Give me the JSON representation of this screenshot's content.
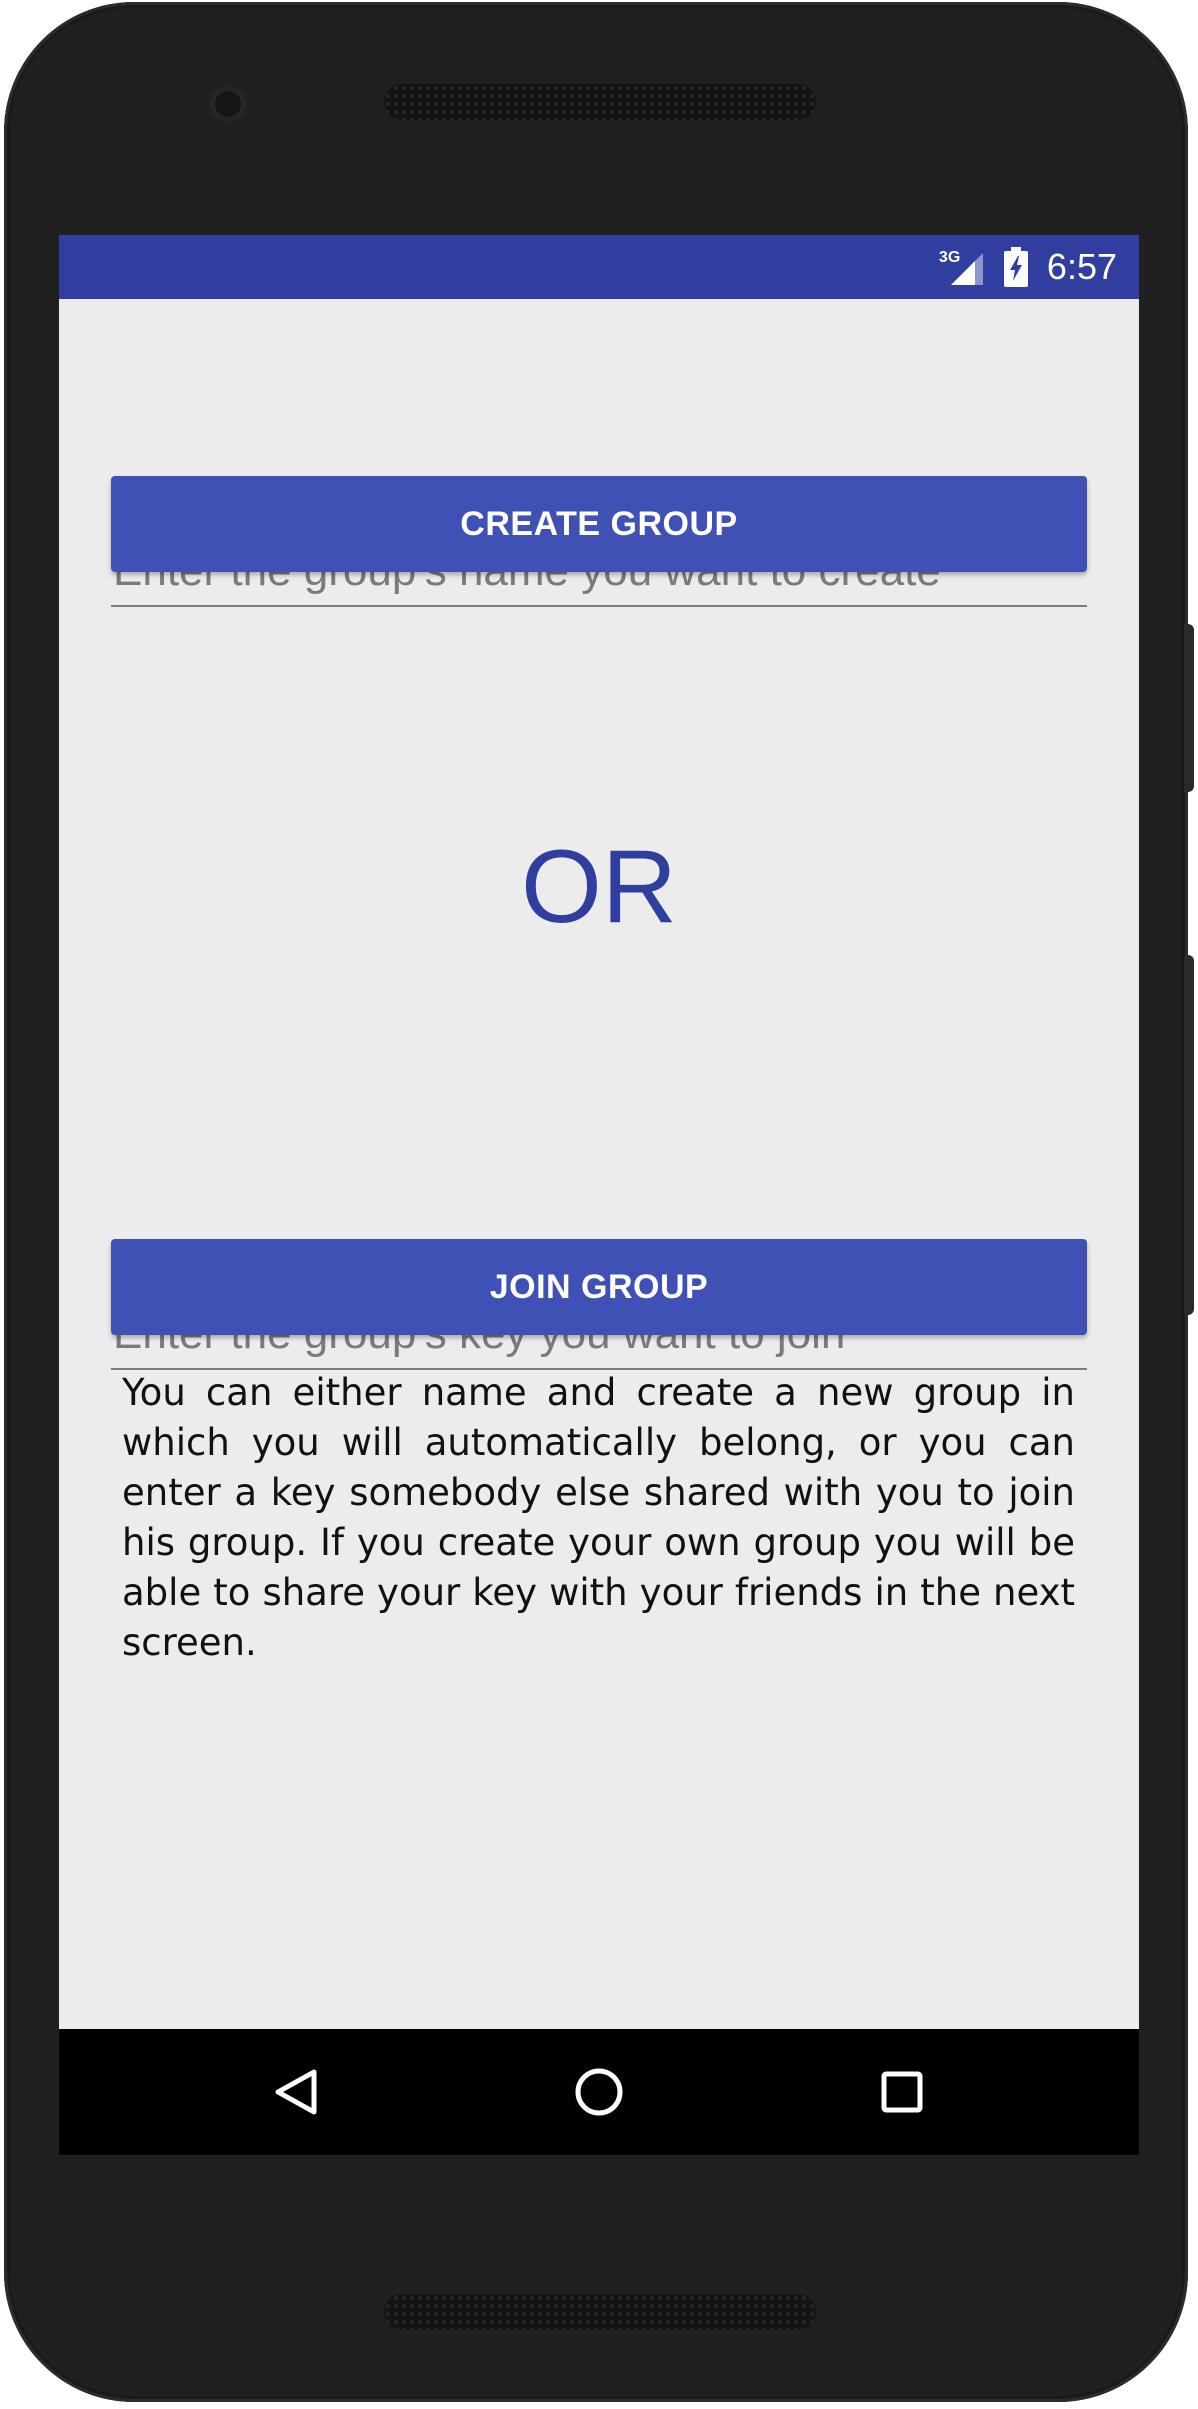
{
  "status_bar": {
    "network_type": "3G",
    "time": "6:57",
    "icons": [
      "signal-icon",
      "battery-charging-icon"
    ],
    "background_color": "#303f9f"
  },
  "create_section": {
    "input_placeholder": "Enter the group's name you want to create",
    "button_label": "CREATE GROUP"
  },
  "divider_text": "OR",
  "join_section": {
    "input_placeholder": "Enter the group's key you want to join",
    "button_label": "JOIN GROUP"
  },
  "help_text": "You can either name and create a new group in which you will automatically belong, or you can enter a key somebody else shared with you to join his group. If you create your own group you will be able to share your key with your friends in the next screen.",
  "nav_bar": {
    "icons": [
      "back-icon",
      "home-icon",
      "recents-icon"
    ]
  },
  "colors": {
    "primary_dark": "#303f9f",
    "primary": "#3f51b5",
    "background": "#ececec"
  }
}
